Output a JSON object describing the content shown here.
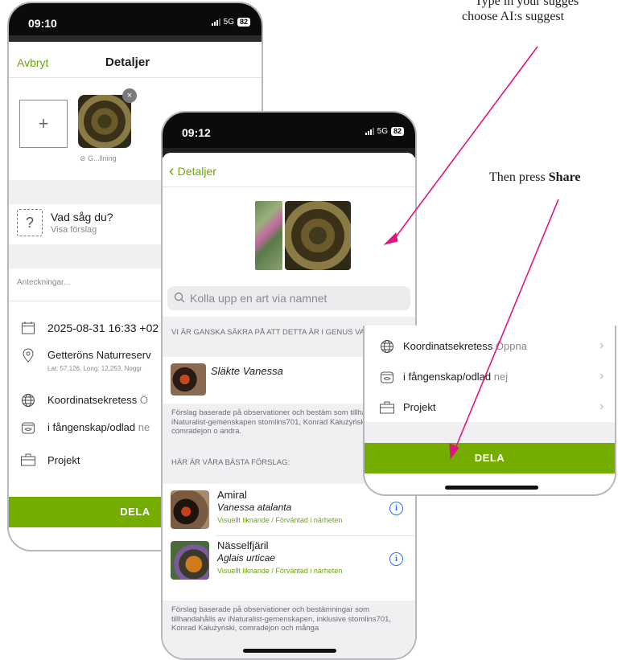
{
  "annotations": {
    "line1": "Type in your sugges",
    "line2": "choose AI:s suggest",
    "then_prefix": "Then press ",
    "then_bold": "Share"
  },
  "phone1": {
    "time": "09:10",
    "network": "5G",
    "battery": "82",
    "cancel": "Avbryt",
    "title": "Detaljer",
    "add_photo": "+",
    "photo_status": "G...llning",
    "what_title": "Vad såg du?",
    "what_sub": "Visa förslag",
    "notes_placeholder": "Anteckningar...",
    "date": "2025-08-31 16:33 +02",
    "place": "Getteröns Naturreserv",
    "place_coords": "Lat: 57,126, Long: 12,253, Noggr",
    "privacy": "Koordinatsekretess",
    "privacy_value": "Ö",
    "captive": "i fångenskap/odlad",
    "captive_value": "ne",
    "projects": "Projekt",
    "share": "DELA"
  },
  "phone2": {
    "time": "09:12",
    "network": "5G",
    "battery": "82",
    "back": "Detaljer",
    "search_placeholder": "Kolla upp en art via namnet",
    "confident_header": "VI ÄR GANSKA SÄKRA PÅ ATT DETTA ÄR I GENUS VANESSA.",
    "genus_name": "Släkte Vanessa",
    "credits1": "Förslag baserade på observationer och bestäm som tillhandahålls av iNaturalist-gemenskapen stomlins701, Konrad Kałużyński, comradejon o andra.",
    "best_header": "HÄR ÄR VÅRA BÄSTA FÖRSLAG:",
    "suggestions": [
      {
        "common": "Amiral",
        "scientific": "Vanessa atalanta",
        "tag": "Visuellt liknande / Förväntad i närheten"
      },
      {
        "common": "Nässelfjäril",
        "scientific": "Aglais urticae",
        "tag": "Visuellt liknande / Förväntad i närheten"
      }
    ],
    "credits2": "Förslag baserade på observationer och bestämningar som tillhandahålls av iNaturalist-gemenskapen, inklusive stomlins701, Konrad Kałużyński, comradejon och många"
  },
  "phone3": {
    "privacy": "Koordinatsekretess",
    "privacy_value": "Öppna",
    "captive": "i fångenskap/odlad",
    "captive_value": "nej",
    "projects": "Projekt",
    "share": "DELA"
  },
  "colors": {
    "accent_green": "#74ac00",
    "arrow_magenta": "#e0157f",
    "link_blue": "#2b73e6"
  }
}
